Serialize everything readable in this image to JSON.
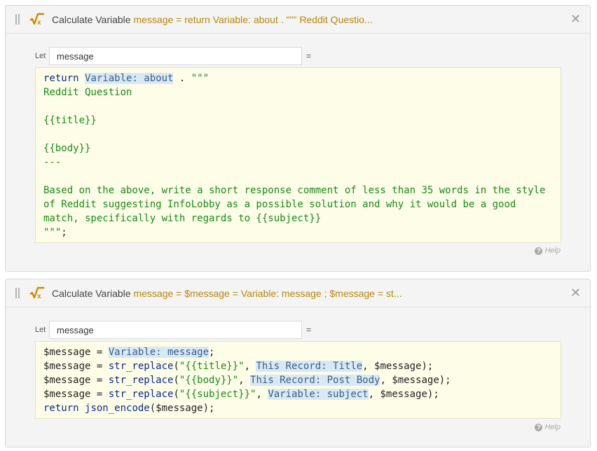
{
  "cards": [
    {
      "label": "Calculate Variable",
      "summary": "message = return Variable: about . \"\"\" Reddit Questio...",
      "let_label": "Let",
      "var_name": "message",
      "eq": "=",
      "help": "Help",
      "code": {
        "l1_kw": "return",
        "l1_tok": "Variable: about",
        "l1_rest": " . ",
        "l1_str": "\"\"\"",
        "l2": "Reddit Question",
        "l4": "{{title}}",
        "l6": "{{body}}",
        "l7": "---",
        "l9": "Based on the above, write a short response comment of less than 35 words in the style",
        "l10": "of Reddit suggesting InfoLobby as a possible solution and why it would be a good",
        "l11": "match, specifically with regards to {{subject}}",
        "l12_str": "\"\"\"",
        "l12_rest": ";"
      }
    },
    {
      "label": "Calculate Variable",
      "summary": "message = $message = Variable: message ; $message = st...",
      "let_label": "Let",
      "var_name": "message",
      "eq": "=",
      "help": "Help",
      "code": {
        "l1_a": "$message = ",
        "l1_tok": "Variable: message",
        "l1_b": ";",
        "l2_a": "$message = ",
        "l2_fn": "str_replace",
        "l2_b": "(",
        "l2_str": "\"{{title}}\"",
        "l2_c": ", ",
        "l2_tok": "This Record: Title",
        "l2_d": ", $message);",
        "l3_a": "$message = ",
        "l3_fn": "str_replace",
        "l3_b": "(",
        "l3_str": "\"{{body}}\"",
        "l3_c": ", ",
        "l3_tok": "This Record: Post Body",
        "l3_d": ", $message);",
        "l4_a": "$message = ",
        "l4_fn": "str_replace",
        "l4_b": "(",
        "l4_str": "\"{{subject}}\"",
        "l4_c": ", ",
        "l4_tok": "Variable: subject",
        "l4_d": ", $message);",
        "l5_kw": "return",
        "l5_sp": " ",
        "l5_fn": "json_encode",
        "l5_b": "($message);"
      }
    }
  ],
  "colors": {
    "accent": "#b8860b",
    "code_bg": "#fdfde8",
    "token_bg": "#d9e8f5",
    "keyword": "#0a2a90",
    "string": "#1a8a1a"
  },
  "icons": [
    "drag-handle-icon",
    "calculator-fx-icon",
    "close-icon",
    "help-icon"
  ]
}
